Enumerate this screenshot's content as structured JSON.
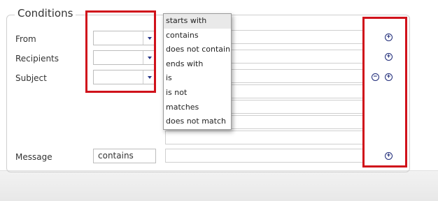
{
  "conditions": {
    "legend": "Conditions",
    "rows": [
      {
        "label": "From",
        "select_value": ""
      },
      {
        "label": "Recipients",
        "select_value": ""
      },
      {
        "label": "Subject",
        "select_value": ""
      }
    ],
    "message": {
      "label": "Message",
      "value": "contains"
    }
  },
  "dropdown": {
    "options": [
      "starts with",
      "contains",
      "does not contain",
      "ends with",
      "is",
      "is not",
      "matches",
      "does not match"
    ],
    "selected": "starts with"
  },
  "buttons": {
    "add_symbol": "+",
    "remove_symbol": "−"
  },
  "colors": {
    "highlight": "#d0121b",
    "icon": "#1e2a78"
  }
}
